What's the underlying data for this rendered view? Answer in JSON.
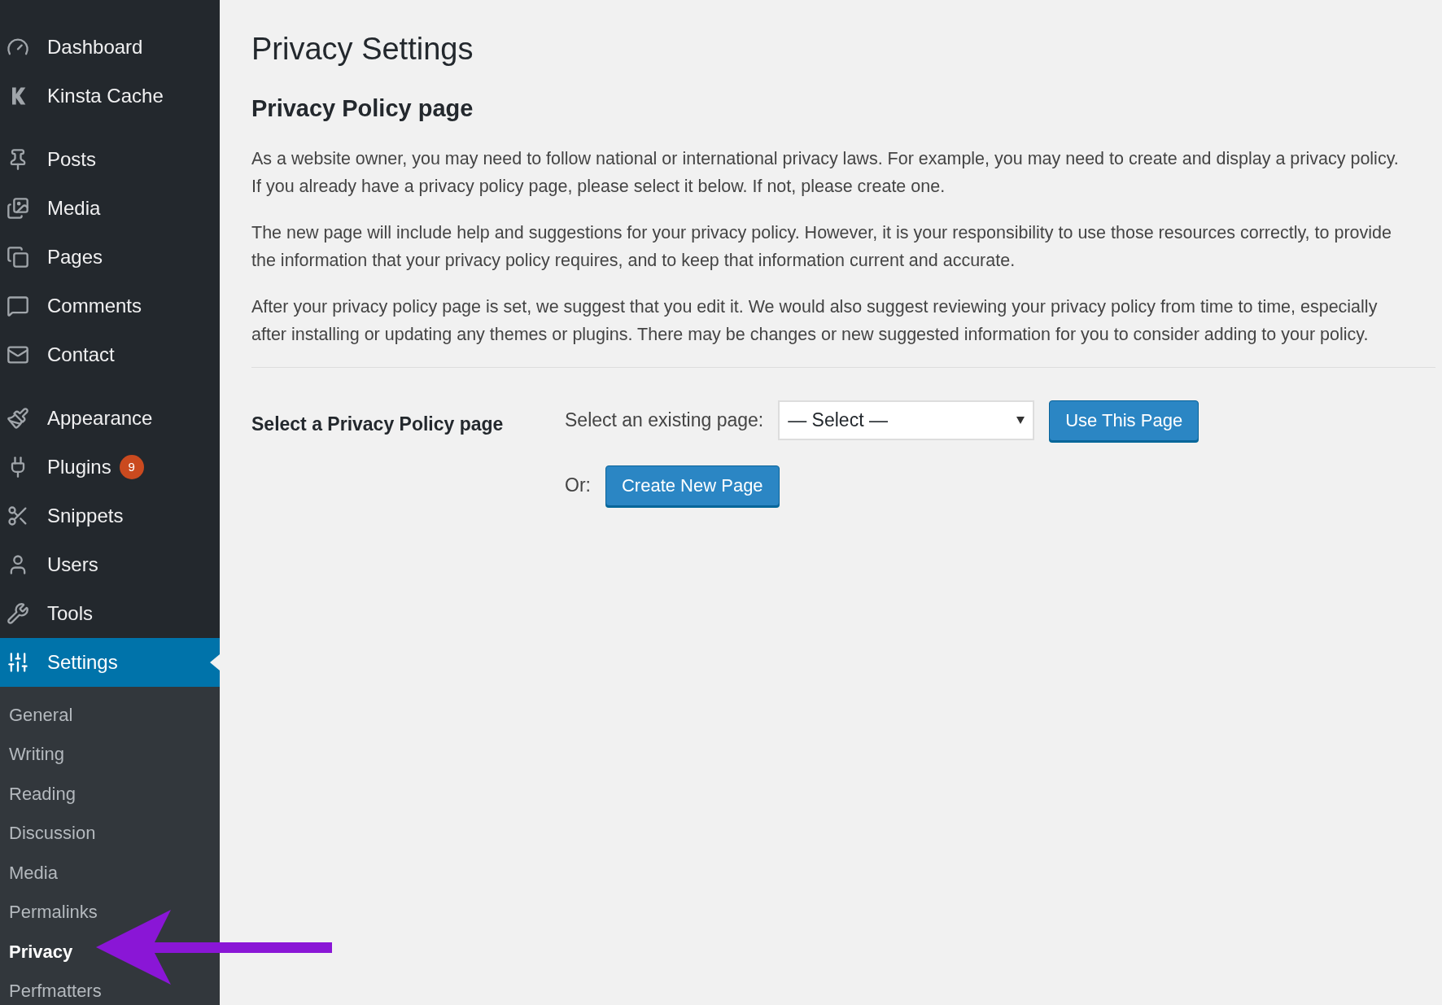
{
  "sidebar": {
    "menu_groups": [
      [
        {
          "label": "Dashboard",
          "selected": false
        },
        {
          "label": "Kinsta Cache",
          "selected": false
        }
      ],
      [
        {
          "label": "Posts",
          "selected": false
        },
        {
          "label": "Media",
          "selected": false
        },
        {
          "label": "Pages",
          "selected": false
        },
        {
          "label": "Comments",
          "selected": false
        },
        {
          "label": "Contact",
          "selected": false
        }
      ],
      [
        {
          "label": "Appearance",
          "selected": false
        },
        {
          "label": "Plugins",
          "selected": false,
          "badge": "9"
        },
        {
          "label": "Snippets",
          "selected": false
        },
        {
          "label": "Users",
          "selected": false
        },
        {
          "label": "Tools",
          "selected": false
        },
        {
          "label": "Settings",
          "selected": true
        }
      ]
    ],
    "submenu": [
      {
        "label": "General",
        "selected": false
      },
      {
        "label": "Writing",
        "selected": false
      },
      {
        "label": "Reading",
        "selected": false
      },
      {
        "label": "Discussion",
        "selected": false
      },
      {
        "label": "Media",
        "selected": false
      },
      {
        "label": "Permalinks",
        "selected": false
      },
      {
        "label": "Privacy",
        "selected": true
      },
      {
        "label": "Perfmatters",
        "selected": false
      }
    ]
  },
  "page": {
    "title": "Privacy Settings",
    "section_title": "Privacy Policy page",
    "paragraphs": [
      "As a website owner, you may need to follow national or international privacy laws. For example, you may need to create and display a privacy policy. If you already have a privacy policy page, please select it below. If not, please create one.",
      "The new page will include help and suggestions for your privacy policy. However, it is your responsibility to use those resources correctly, to provide the information that your privacy policy requires, and to keep that information current and accurate.",
      "After your privacy policy page is set, we suggest that you edit it. We would also suggest reviewing your privacy policy from time to time, especially after installing or updating any themes or plugins. There may be changes or new suggested information for you to consider adding to your policy."
    ],
    "form": {
      "row_label": "Select a Privacy Policy page",
      "select_label": "Select an existing page:",
      "select_value": "— Select —",
      "use_button": "Use This Page",
      "or_label": "Or:",
      "create_button": "Create New Page"
    }
  }
}
